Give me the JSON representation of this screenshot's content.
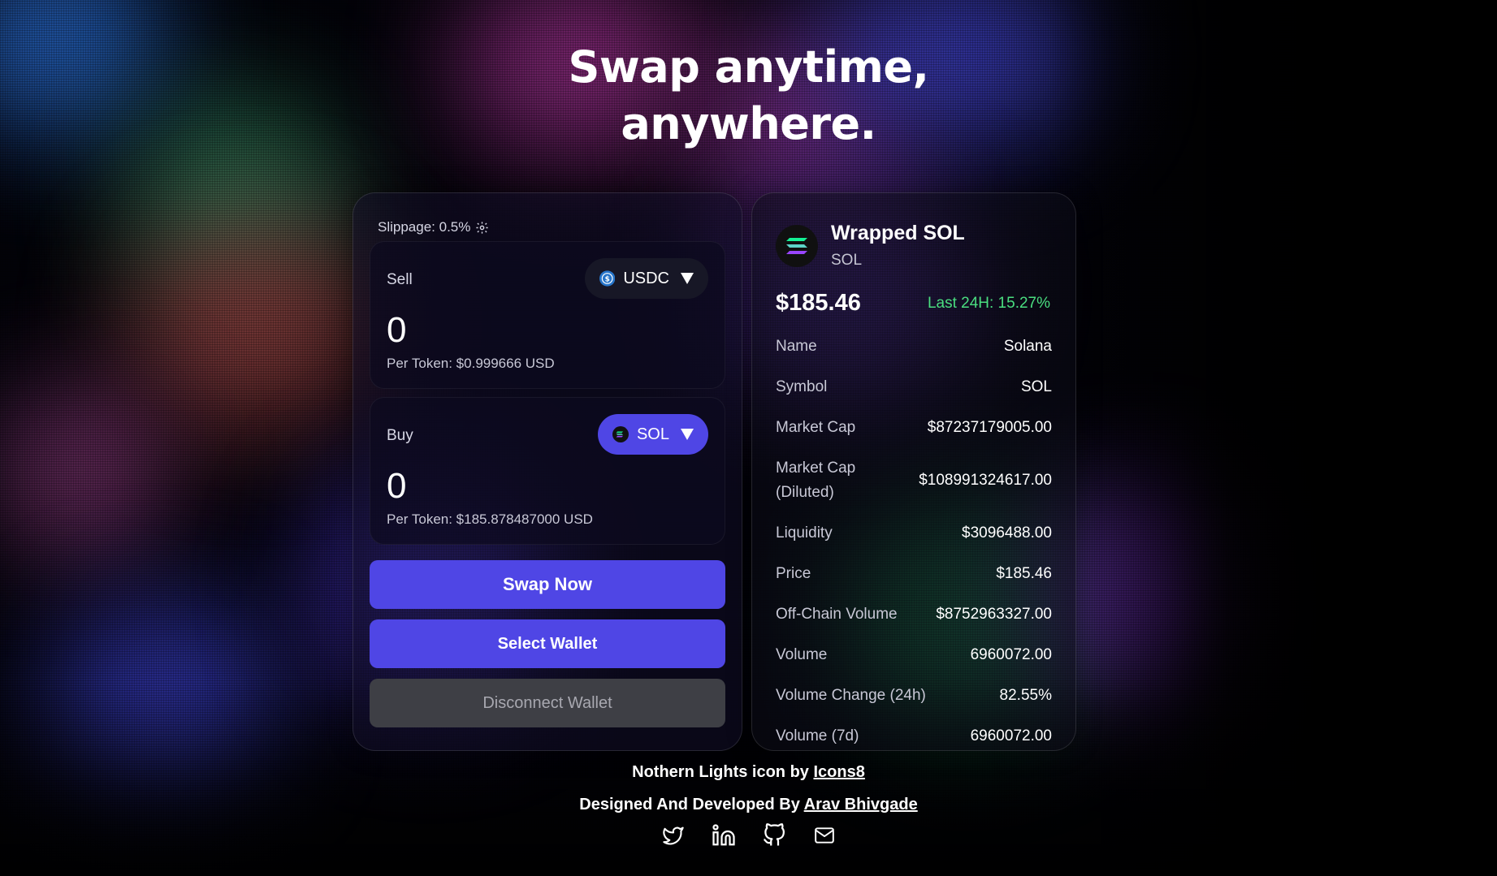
{
  "hero": {
    "line1": "Swap anytime,",
    "line2": "anywhere."
  },
  "swap": {
    "slippage_label": "Slippage: 0.5%",
    "sell": {
      "label": "Sell",
      "amount": "0",
      "token": "USDC",
      "per_token": "Per Token: $0.999666 USD"
    },
    "buy": {
      "label": "Buy",
      "amount": "0",
      "token": "SOL",
      "per_token": "Per Token: $185.878487000 USD"
    },
    "swap_button": "Swap Now",
    "select_wallet_button": "Select Wallet",
    "disconnect_wallet_button": "Disconnect Wallet"
  },
  "token_info": {
    "name": "Wrapped SOL",
    "symbol": "SOL",
    "price": "$185.46",
    "change_24h": "Last 24H: 15.27%",
    "stats": [
      {
        "label": "Name",
        "value": "Solana"
      },
      {
        "label": "Symbol",
        "value": "SOL"
      },
      {
        "label": "Market Cap",
        "value": "$87237179005.00"
      },
      {
        "label": "Market Cap",
        "label2": "(Diluted)",
        "value": "$108991324617.00"
      },
      {
        "label": "Liquidity",
        "value": "$3096488.00"
      },
      {
        "label": "Price",
        "value": "$185.46"
      },
      {
        "label": "Off-Chain Volume",
        "value": "$8752963327.00"
      },
      {
        "label": "Volume",
        "value": "6960072.00"
      },
      {
        "label": "Volume Change (24h)",
        "value": "82.55%"
      },
      {
        "label": "Volume (7d)",
        "value": "6960072.00"
      }
    ]
  },
  "footer": {
    "credit1_prefix": "Nothern Lights icon by",
    "credit1_link": "Icons8",
    "credit2_prefix": "Designed And Developed By",
    "credit2_link": "Arav Bhivgade",
    "socials": [
      "twitter-icon",
      "linkedin-icon",
      "github-icon",
      "mail-icon"
    ]
  },
  "colors": {
    "accent": "#4f46e5",
    "positive": "#4ade80",
    "disabled_button": "#3e3f45"
  }
}
